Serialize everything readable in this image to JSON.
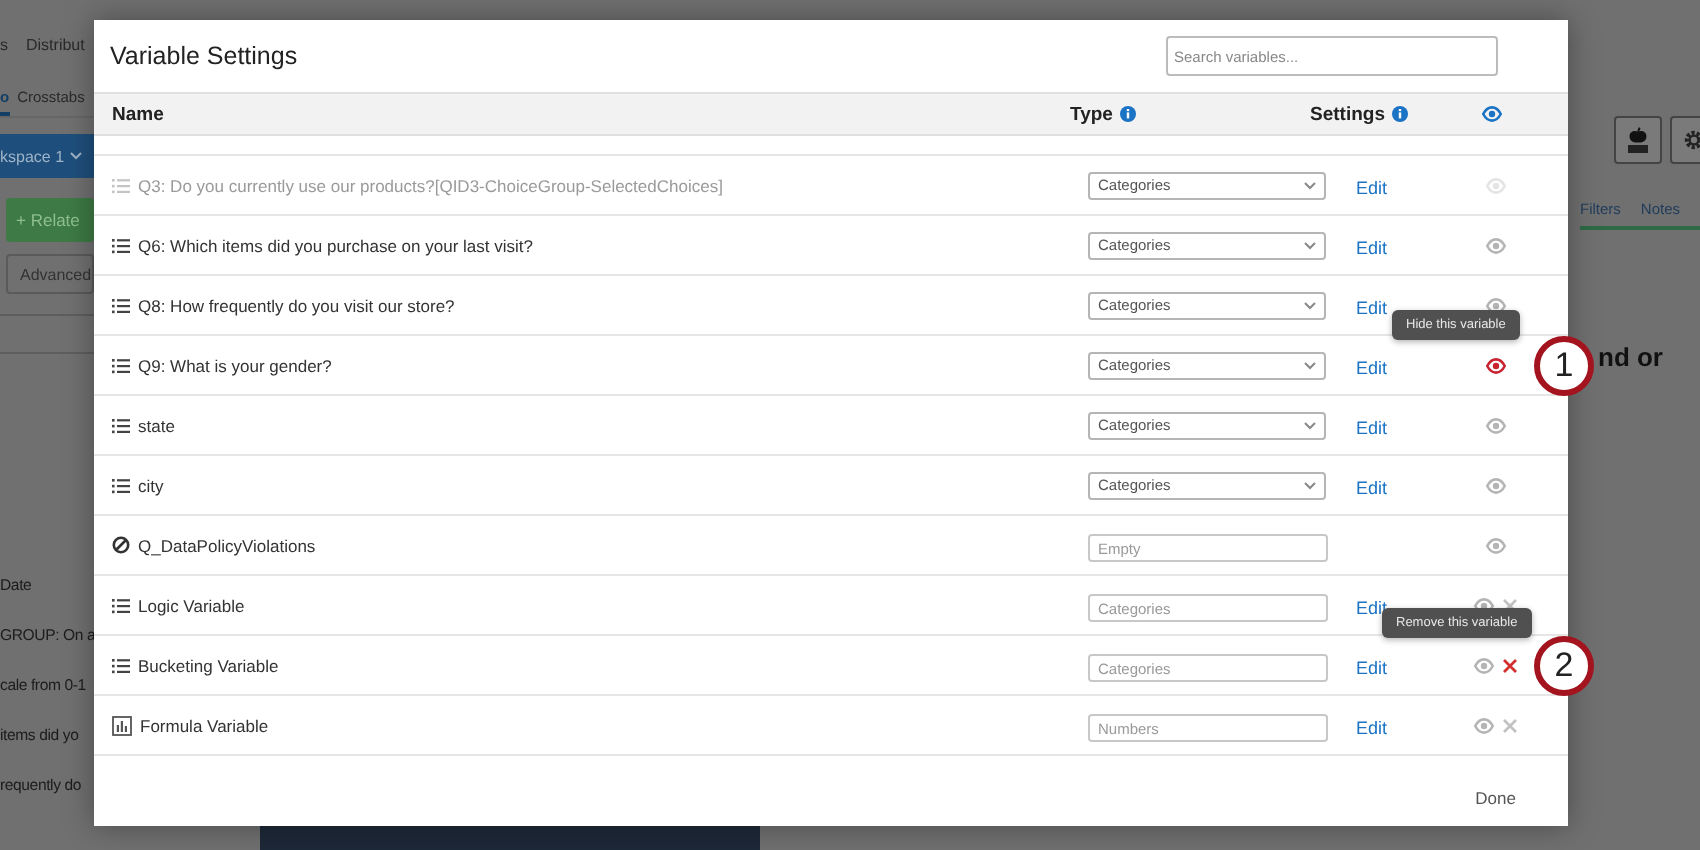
{
  "background_left": {
    "tabs": [
      "s",
      "Distribut"
    ],
    "subtabs": [
      {
        "label": "o",
        "selected": true
      },
      {
        "label": "Crosstabs",
        "selected": false
      }
    ],
    "workspace": "kspace 1",
    "relate_button": "+ Relate",
    "advanced_button": "Advanced",
    "lines": [
      "Date",
      "GROUP: On a",
      "cale from 0-1",
      "items did yo",
      "requently do"
    ]
  },
  "background_right": {
    "tabs": [
      "Filters",
      "Notes"
    ],
    "heading": "nd or"
  },
  "modal": {
    "title": "Variable Settings",
    "search": {
      "placeholder": "Search variables..."
    },
    "columns": [
      "Name",
      "Type",
      "Settings"
    ],
    "rows": [
      {
        "name": "Q3: Do you currently use our products?[QID3-ChoiceGroup-SelectedChoices]",
        "kind": "choice",
        "muted": true,
        "type": {
          "kind": "dropdown",
          "value": "Categories"
        },
        "edit": "Edit",
        "eye_hovered": false,
        "removable": false,
        "remove_hovered": false
      },
      {
        "name": "Q6: Which items did you purchase on your last visit?",
        "kind": "choice",
        "muted": false,
        "type": {
          "kind": "dropdown",
          "value": "Categories"
        },
        "edit": "Edit",
        "eye_hovered": false,
        "removable": false,
        "remove_hovered": false
      },
      {
        "name": "Q8: How frequently do you visit our store?",
        "kind": "choice",
        "muted": false,
        "type": {
          "kind": "dropdown",
          "value": "Categories"
        },
        "edit": "Edit",
        "eye_hovered": false,
        "removable": false,
        "remove_hovered": false
      },
      {
        "name": "Q9: What is your gender?",
        "kind": "choice",
        "muted": false,
        "type": {
          "kind": "dropdown",
          "value": "Categories"
        },
        "edit": "Edit",
        "eye_hovered": true,
        "removable": false,
        "remove_hovered": false,
        "tooltip": "Hide this variable",
        "callout": "1"
      },
      {
        "name": "state",
        "kind": "choice",
        "muted": false,
        "type": {
          "kind": "dropdown",
          "value": "Categories"
        },
        "edit": "Edit",
        "eye_hovered": false,
        "removable": false,
        "remove_hovered": false
      },
      {
        "name": "city",
        "kind": "choice",
        "muted": false,
        "type": {
          "kind": "dropdown",
          "value": "Categories"
        },
        "edit": "Edit",
        "eye_hovered": false,
        "removable": false,
        "remove_hovered": false
      },
      {
        "name": "Q_DataPolicyViolations",
        "kind": "blocked",
        "muted": false,
        "type": {
          "kind": "field",
          "placeholder": "Empty"
        },
        "eye_hovered": false,
        "removable": false,
        "remove_hovered": false
      },
      {
        "name": "Logic Variable",
        "kind": "choice",
        "muted": false,
        "type": {
          "kind": "field",
          "placeholder": "Categories"
        },
        "edit": "Edit",
        "eye_hovered": false,
        "removable": true,
        "remove_hovered": false
      },
      {
        "name": "Bucketing Variable",
        "kind": "choice",
        "muted": false,
        "type": {
          "kind": "field",
          "placeholder": "Categories"
        },
        "edit": "Edit",
        "eye_hovered": false,
        "removable": true,
        "remove_hovered": true,
        "tooltip": "Remove this variable",
        "callout": "2"
      },
      {
        "name": "Formula Variable",
        "kind": "formula",
        "muted": false,
        "type": {
          "kind": "field",
          "placeholder": "Numbers"
        },
        "edit": "Edit",
        "eye_hovered": false,
        "removable": true,
        "remove_hovered": false
      }
    ],
    "done_button": "Done"
  }
}
